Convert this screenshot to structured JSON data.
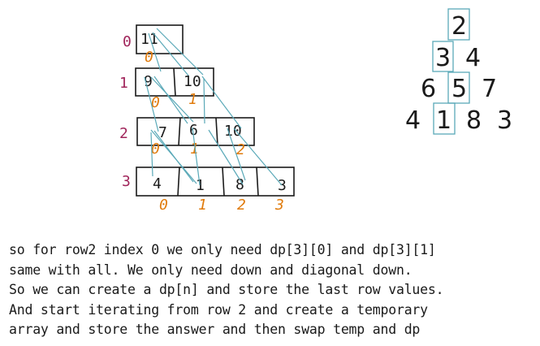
{
  "grid": {
    "rows": [
      {
        "label": "0",
        "cells": [
          "11"
        ],
        "indices": [
          "0"
        ]
      },
      {
        "label": "1",
        "cells": [
          "9",
          "10"
        ],
        "indices": [
          "0",
          "1"
        ]
      },
      {
        "label": "2",
        "cells": [
          "7",
          "6",
          "10"
        ],
        "indices": [
          "0",
          "1",
          "2"
        ]
      },
      {
        "label": "3",
        "cells": [
          "4",
          "1",
          "8",
          "3"
        ],
        "indices": [
          "0",
          "1",
          "2",
          "3"
        ]
      }
    ]
  },
  "triangle": {
    "rows": [
      [
        "2"
      ],
      [
        "3",
        "4"
      ],
      [
        "6",
        "5",
        "7"
      ],
      [
        "4",
        "1",
        "8",
        "3"
      ]
    ],
    "highlighted": [
      "0-0",
      "1-0",
      "2-1",
      "3-1"
    ]
  },
  "notes": [
    "so for row2 index 0 we only need dp[3][0] and dp[3][1]",
    "same with all. We only need down and diagonal down.",
    "So we can create a dp[n] and store the last row values.",
    "And start iterating from row 2 and create a temporary",
    "array and store the answer and then swap temp and dp"
  ],
  "colors": {
    "row_label": "#a0245a",
    "index_label": "#e07b0c",
    "highlight": "#5aa9b8",
    "ink": "#1a1a1a"
  }
}
